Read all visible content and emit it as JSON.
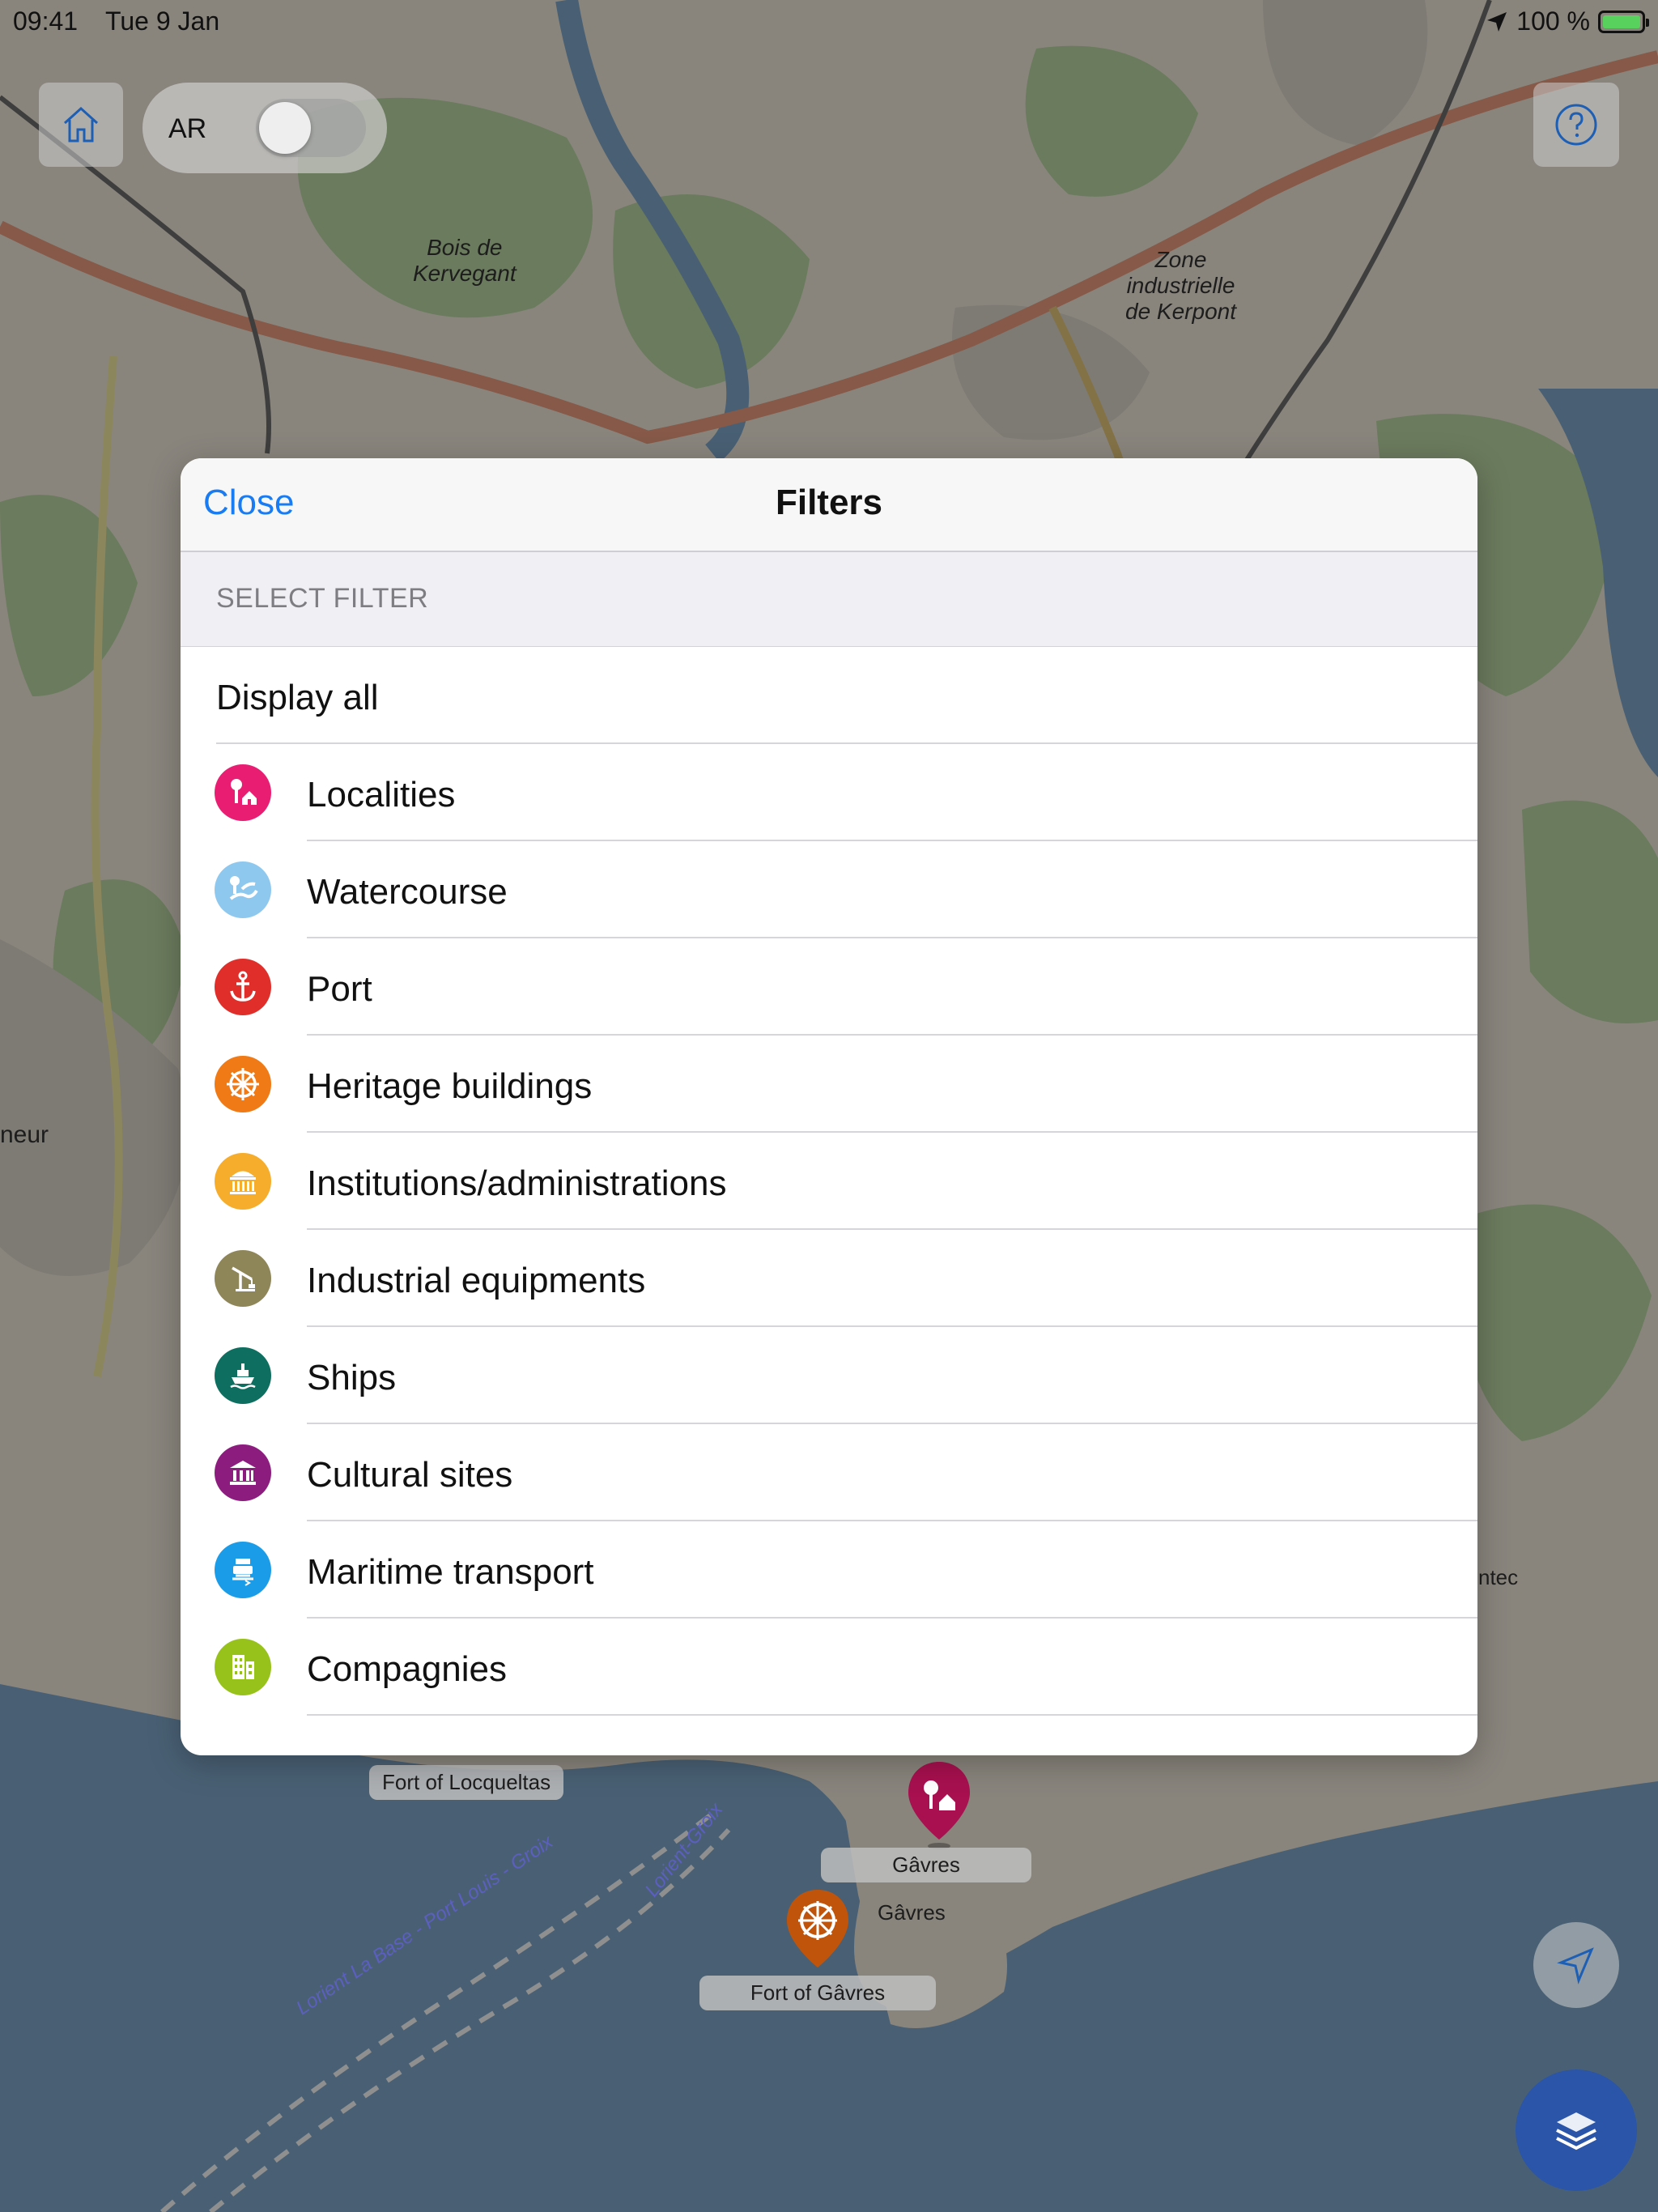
{
  "status_bar": {
    "time": "09:41",
    "date": "Tue 9 Jan",
    "battery": "100 %",
    "location_icon": "location-arrow-icon",
    "battery_icon": "battery-charging-icon"
  },
  "controls": {
    "home_icon": "home-icon",
    "ar_label": "AR",
    "ar_toggle_on": false,
    "help_icon": "question-circle-icon",
    "locate_icon": "navigation-arrow-icon",
    "layers_icon": "layers-icon"
  },
  "map": {
    "labels": [
      "Bois de\nKervegant",
      "Zone\nindustrielle\nde Kerpont",
      "neur",
      "ntec",
      "Gâvres",
      "Lorient La Base - Port Louis - Groix",
      "Lorient-Groix"
    ],
    "markers": [
      {
        "label": "Fort of Locqueltas"
      },
      {
        "label": "Gâvres",
        "icon": "localities-pin-icon",
        "color": "#a8104f"
      },
      {
        "label": "Fort of Gâvres",
        "icon": "heritage-pin-icon",
        "color": "#c0540b"
      }
    ]
  },
  "modal": {
    "close_label": "Close",
    "title": "Filters",
    "section_header": "SELECT FILTER",
    "display_all": "Display all",
    "items": [
      {
        "label": "Localities",
        "icon": "localities-icon",
        "color": "#e91e73"
      },
      {
        "label": "Watercourse",
        "icon": "watercourse-icon",
        "color": "#8fc8ef"
      },
      {
        "label": "Port",
        "icon": "anchor-icon",
        "color": "#e02e2a"
      },
      {
        "label": "Heritage buildings",
        "icon": "ship-wheel-icon",
        "color": "#f07a15"
      },
      {
        "label": "Institutions/administrations",
        "icon": "institution-icon",
        "color": "#f6ad2c"
      },
      {
        "label": "Industrial equipments",
        "icon": "crane-icon",
        "color": "#8e8559"
      },
      {
        "label": "Ships",
        "icon": "ship-icon",
        "color": "#0e6e5f"
      },
      {
        "label": "Cultural sites",
        "icon": "museum-icon",
        "color": "#8d1c7f"
      },
      {
        "label": "Maritime transport",
        "icon": "ferry-icon",
        "color": "#1a9ce8"
      },
      {
        "label": "Compagnies",
        "icon": "building-icon",
        "color": "#97c21b"
      }
    ]
  }
}
